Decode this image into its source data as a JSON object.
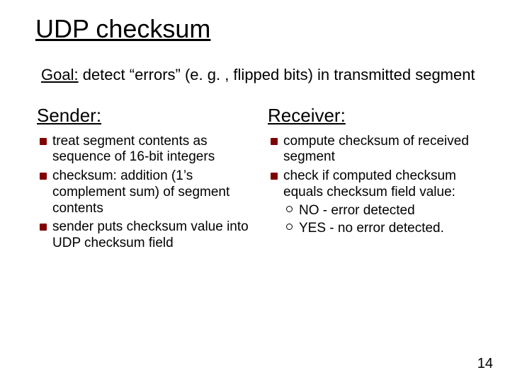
{
  "title": "UDP checksum",
  "goal_label": "Goal:",
  "goal_text": " detect “errors” (e. g. , flipped bits) in transmitted segment",
  "sender": {
    "heading": "Sender:",
    "items": [
      "treat segment contents as sequence of 16-bit integers",
      "checksum: addition (1’s complement sum) of segment contents",
      "sender puts checksum value into UDP checksum field"
    ]
  },
  "receiver": {
    "heading": "Receiver:",
    "items": [
      {
        "text": "compute checksum of received segment"
      },
      {
        "text": "check if computed checksum equals checksum field value:",
        "subs": [
          "NO - error detected",
          "YES - no error detected."
        ]
      }
    ]
  },
  "page_number": "14"
}
